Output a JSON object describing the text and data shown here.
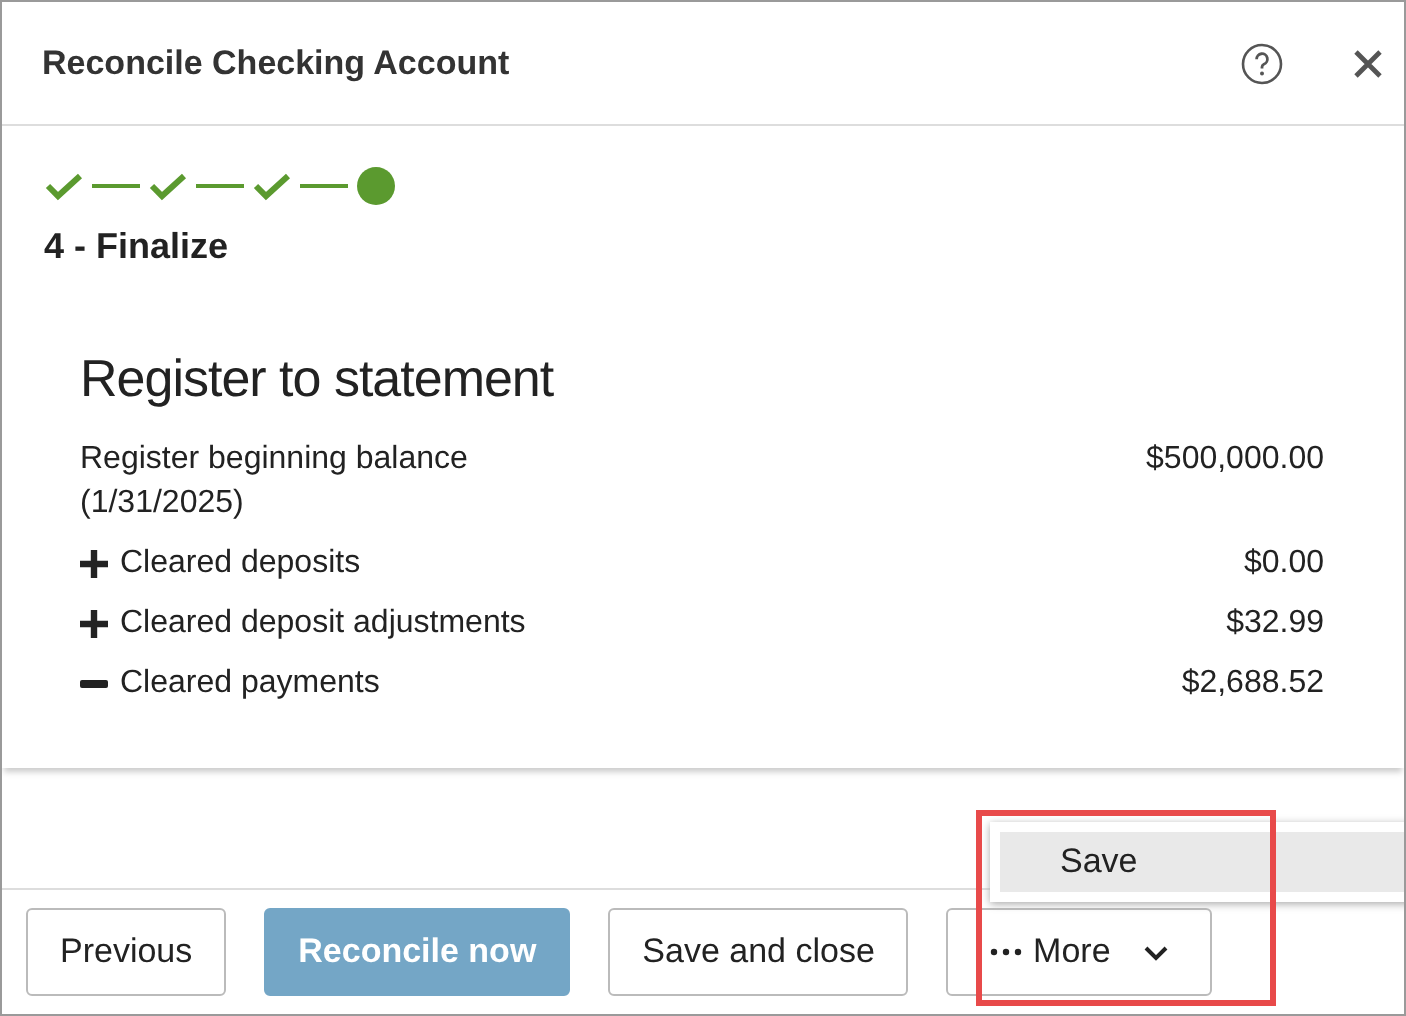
{
  "window": {
    "title": "Reconcile Checking Account"
  },
  "steps": [
    {
      "kind": "done"
    },
    {
      "kind": "done"
    },
    {
      "kind": "done"
    },
    {
      "kind": "current"
    }
  ],
  "step_label": "4 - Finalize",
  "section": {
    "heading": "Register to statement",
    "rows": [
      {
        "kind": "plain",
        "label": "Register beginning balance",
        "note": "(1/31/2025)",
        "amount": "$500,000.00"
      },
      {
        "kind": "plus",
        "label": "Cleared deposits",
        "amount": "$0.00"
      },
      {
        "kind": "plus",
        "label": "Cleared deposit adjustments",
        "amount": "$32.99"
      },
      {
        "kind": "minus",
        "label": "Cleared payments",
        "amount": "$2,688.52"
      }
    ]
  },
  "menu": {
    "items": [
      {
        "label": "Save",
        "selected": true
      }
    ]
  },
  "buttons": [
    {
      "kind": "secondary",
      "label": "Previous"
    },
    {
      "kind": "primary",
      "label": "Reconcile now"
    },
    {
      "kind": "secondary",
      "label": "Save and close"
    },
    {
      "kind": "more",
      "label": "More"
    }
  ],
  "highlight": {
    "shown": true
  }
}
